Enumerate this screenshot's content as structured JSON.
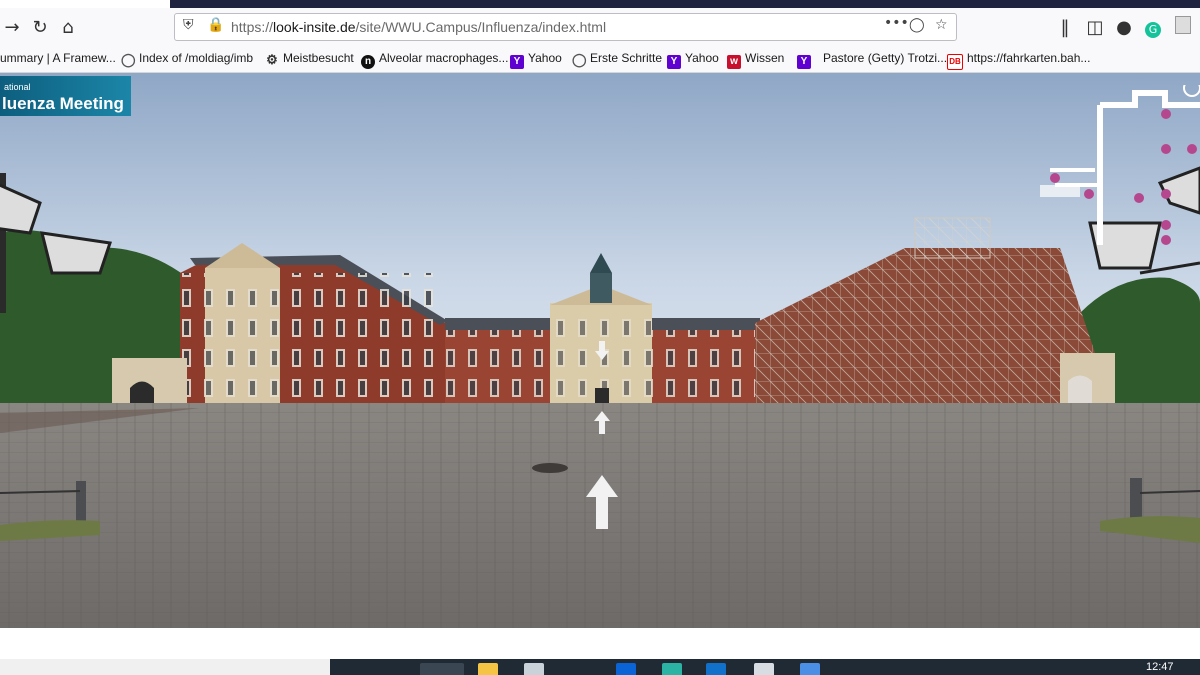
{
  "browser": {
    "url_prefix": "https://",
    "url_host": "look-insite.de",
    "url_path": "/site/WWU.Campus/Influenza/index.html",
    "back_icon": "back-arrow-icon",
    "reload_icon": "reload-icon",
    "home_icon": "home-icon"
  },
  "bookmarks": [
    {
      "label": "ummary | A Framew...",
      "icon": "bookmark-favicon"
    },
    {
      "label": "Index of /moldiag/imb",
      "icon": "globe-icon"
    },
    {
      "label": "Meistbesucht",
      "icon": "gear-icon"
    },
    {
      "label": "Alveolar macrophages...",
      "icon": "bookmark-favicon"
    },
    {
      "label": "Yahoo",
      "icon": "yahoo-icon"
    },
    {
      "label": "Erste Schritte",
      "icon": "globe-icon"
    },
    {
      "label": "Yahoo",
      "icon": "yahoo-icon"
    },
    {
      "label": "Wissen",
      "icon": "bookmark-favicon"
    },
    {
      "label": "Pastore (Getty) Trotzi...",
      "icon": "yahoo-icon"
    },
    {
      "label": "https://fahrkarten.bah...",
      "icon": "db-icon"
    }
  ],
  "logo": {
    "line1": "ational",
    "line2": "luenza Meeting"
  },
  "taskbar": {
    "clock": "12:47"
  },
  "colors": {
    "accent": "#1f2340",
    "map_dot": "#b5478e",
    "logo_bg": "#0d5e7e"
  }
}
